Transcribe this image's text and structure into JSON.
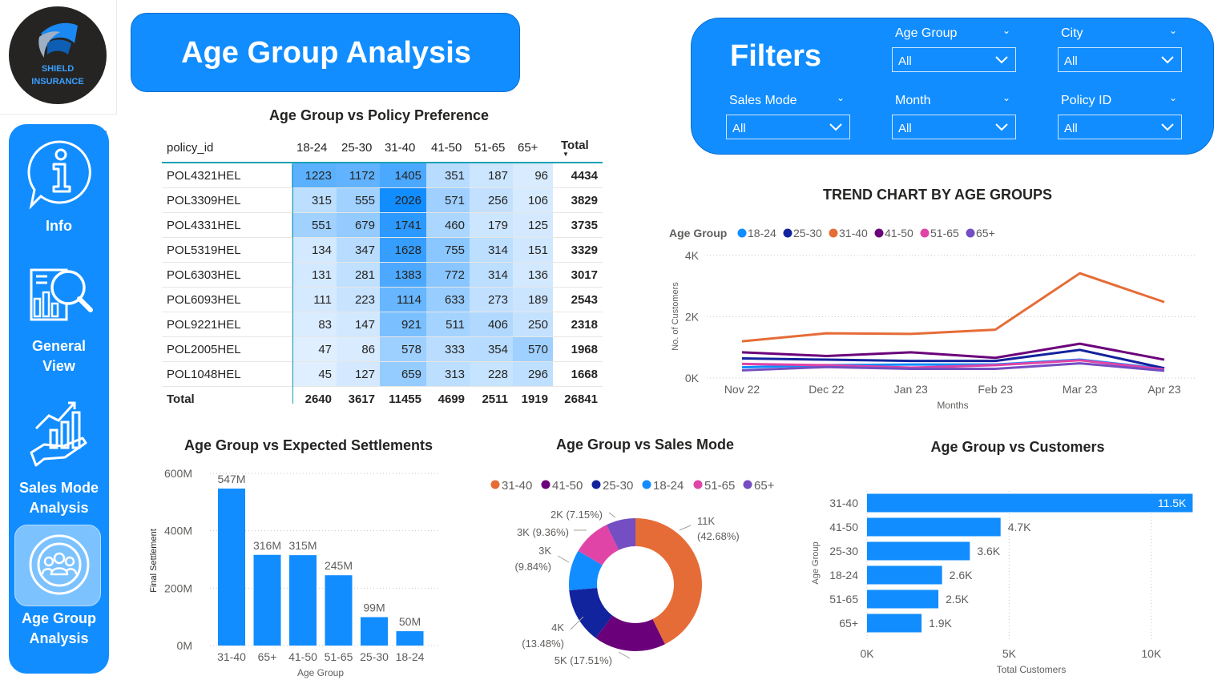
{
  "logo": {
    "line1": "SHIELD",
    "line2": "INSURANCE"
  },
  "nav": [
    {
      "label_lines": [
        "Info"
      ],
      "icon": "info-bubble-icon"
    },
    {
      "label_lines": [
        "General",
        "View"
      ],
      "icon": "report-search-icon"
    },
    {
      "label_lines": [
        "Sales Mode",
        "Analysis"
      ],
      "icon": "growth-hand-icon"
    },
    {
      "label_lines": [
        "Age Group",
        "Analysis"
      ],
      "icon": "group-target-icon",
      "active": true
    }
  ],
  "title": "Age Group Analysis",
  "filters": {
    "heading": "Filters",
    "items": [
      {
        "label": "Age Group",
        "value": "All"
      },
      {
        "label": "City",
        "value": "All"
      },
      {
        "label": "Sales Mode",
        "value": "All"
      },
      {
        "label": "Month",
        "value": "All"
      },
      {
        "label": "Policy ID",
        "value": "All"
      }
    ]
  },
  "matrix": {
    "title": "Age Group vs Policy Preference",
    "row_header": "policy_id",
    "columns": [
      "18-24",
      "25-30",
      "31-40",
      "41-50",
      "51-65",
      "65+",
      "Total"
    ],
    "rows": [
      {
        "id": "POL4321HEL",
        "values": [
          1223,
          1172,
          1405,
          351,
          187,
          96,
          4434
        ]
      },
      {
        "id": "POL3309HEL",
        "values": [
          315,
          555,
          2026,
          571,
          256,
          106,
          3829
        ]
      },
      {
        "id": "POL4331HEL",
        "values": [
          551,
          679,
          1741,
          460,
          179,
          125,
          3735
        ]
      },
      {
        "id": "POL5319HEL",
        "values": [
          134,
          347,
          1628,
          755,
          314,
          151,
          3329
        ]
      },
      {
        "id": "POL6303HEL",
        "values": [
          131,
          281,
          1383,
          772,
          314,
          136,
          3017
        ]
      },
      {
        "id": "POL6093HEL",
        "values": [
          111,
          223,
          1114,
          633,
          273,
          189,
          2543
        ]
      },
      {
        "id": "POL9221HEL",
        "values": [
          83,
          147,
          921,
          511,
          406,
          250,
          2318
        ]
      },
      {
        "id": "POL2005HEL",
        "values": [
          47,
          86,
          578,
          333,
          354,
          570,
          1968
        ]
      },
      {
        "id": "POL1048HEL",
        "values": [
          45,
          127,
          659,
          313,
          228,
          296,
          1668
        ]
      }
    ],
    "total_label": "Total",
    "totals": [
      2640,
      3617,
      11455,
      4699,
      2511,
      1919,
      26841
    ]
  },
  "colors": {
    "accent": "#118dff",
    "18-24": "#118dff",
    "25-30": "#12239e",
    "31-40": "#e66c37",
    "41-50": "#6b007b",
    "51-65": "#e044a7",
    "65+": "#744ec2"
  },
  "chart_data": [
    {
      "type": "line",
      "title": "TREND CHART BY AGE GROUPS",
      "legend_title": "Age Group",
      "xlabel": "Months",
      "ylabel": "No. of Customers",
      "categories": [
        "Nov 22",
        "Dec 22",
        "Jan 23",
        "Feb 23",
        "Mar 23",
        "Apr 23"
      ],
      "ytick_labels": [
        "0K",
        "2K",
        "4K"
      ],
      "ylim": [
        0,
        4000
      ],
      "series": [
        {
          "name": "18-24",
          "values": [
            350,
            420,
            440,
            440,
            600,
            300
          ]
        },
        {
          "name": "25-30",
          "values": [
            640,
            600,
            560,
            560,
            920,
            320
          ]
        },
        {
          "name": "31-40",
          "values": [
            1200,
            1460,
            1440,
            1580,
            3420,
            2480
          ]
        },
        {
          "name": "41-50",
          "values": [
            840,
            720,
            840,
            660,
            1120,
            600
          ]
        },
        {
          "name": "51-65",
          "values": [
            460,
            420,
            340,
            420,
            580,
            280
          ]
        },
        {
          "name": "65+",
          "values": [
            250,
            360,
            300,
            300,
            480,
            240
          ]
        }
      ],
      "legend_position": "top-left",
      "grid": true
    },
    {
      "type": "bar",
      "title": "Age Group vs Expected Settlements",
      "xlabel": "Age Group",
      "ylabel": "Final Settlement",
      "categories": [
        "31-40",
        "65+",
        "41-50",
        "51-65",
        "25-30",
        "18-24"
      ],
      "values": [
        547,
        316,
        315,
        245,
        99,
        50
      ],
      "data_labels": [
        "547M",
        "316M",
        "315M",
        "245M",
        "99M",
        "50M"
      ],
      "ytick_labels": [
        "0M",
        "200M",
        "400M",
        "600M"
      ],
      "ylim": [
        0,
        600
      ],
      "grid": true
    },
    {
      "type": "pie",
      "title": "Age Group vs Sales Mode",
      "legend": [
        "31-40",
        "41-50",
        "25-30",
        "18-24",
        "51-65",
        "65+"
      ],
      "slices": [
        {
          "name": "31-40",
          "value": 42.68,
          "label1": "11K",
          "label2": "(42.68%)"
        },
        {
          "name": "41-50",
          "value": 17.51,
          "label1": "5K (17.51%)",
          "label2": ""
        },
        {
          "name": "25-30",
          "value": 13.48,
          "label1": "4K",
          "label2": "(13.48%)"
        },
        {
          "name": "18-24",
          "value": 9.84,
          "label1": "3K",
          "label2": "(9.84%)"
        },
        {
          "name": "51-65",
          "value": 9.36,
          "label1": "3K (9.36%)",
          "label2": ""
        },
        {
          "name": "65+",
          "value": 7.15,
          "label1": "2K (7.15%)",
          "label2": ""
        }
      ],
      "legend_position": "top"
    },
    {
      "type": "bar",
      "orientation": "horizontal",
      "title": "Age Group vs Customers",
      "xlabel": "Total Customers",
      "ylabel": "Age Group",
      "categories": [
        "31-40",
        "41-50",
        "25-30",
        "18-24",
        "51-65",
        "65+"
      ],
      "values": [
        11455,
        4699,
        3617,
        2640,
        2511,
        1919
      ],
      "data_labels": [
        "11.5K",
        "4.7K",
        "3.6K",
        "2.6K",
        "2.5K",
        "1.9K"
      ],
      "xtick_labels": [
        "0K",
        "5K",
        "10K"
      ],
      "xlim": [
        0,
        11500
      ],
      "grid": true
    }
  ]
}
